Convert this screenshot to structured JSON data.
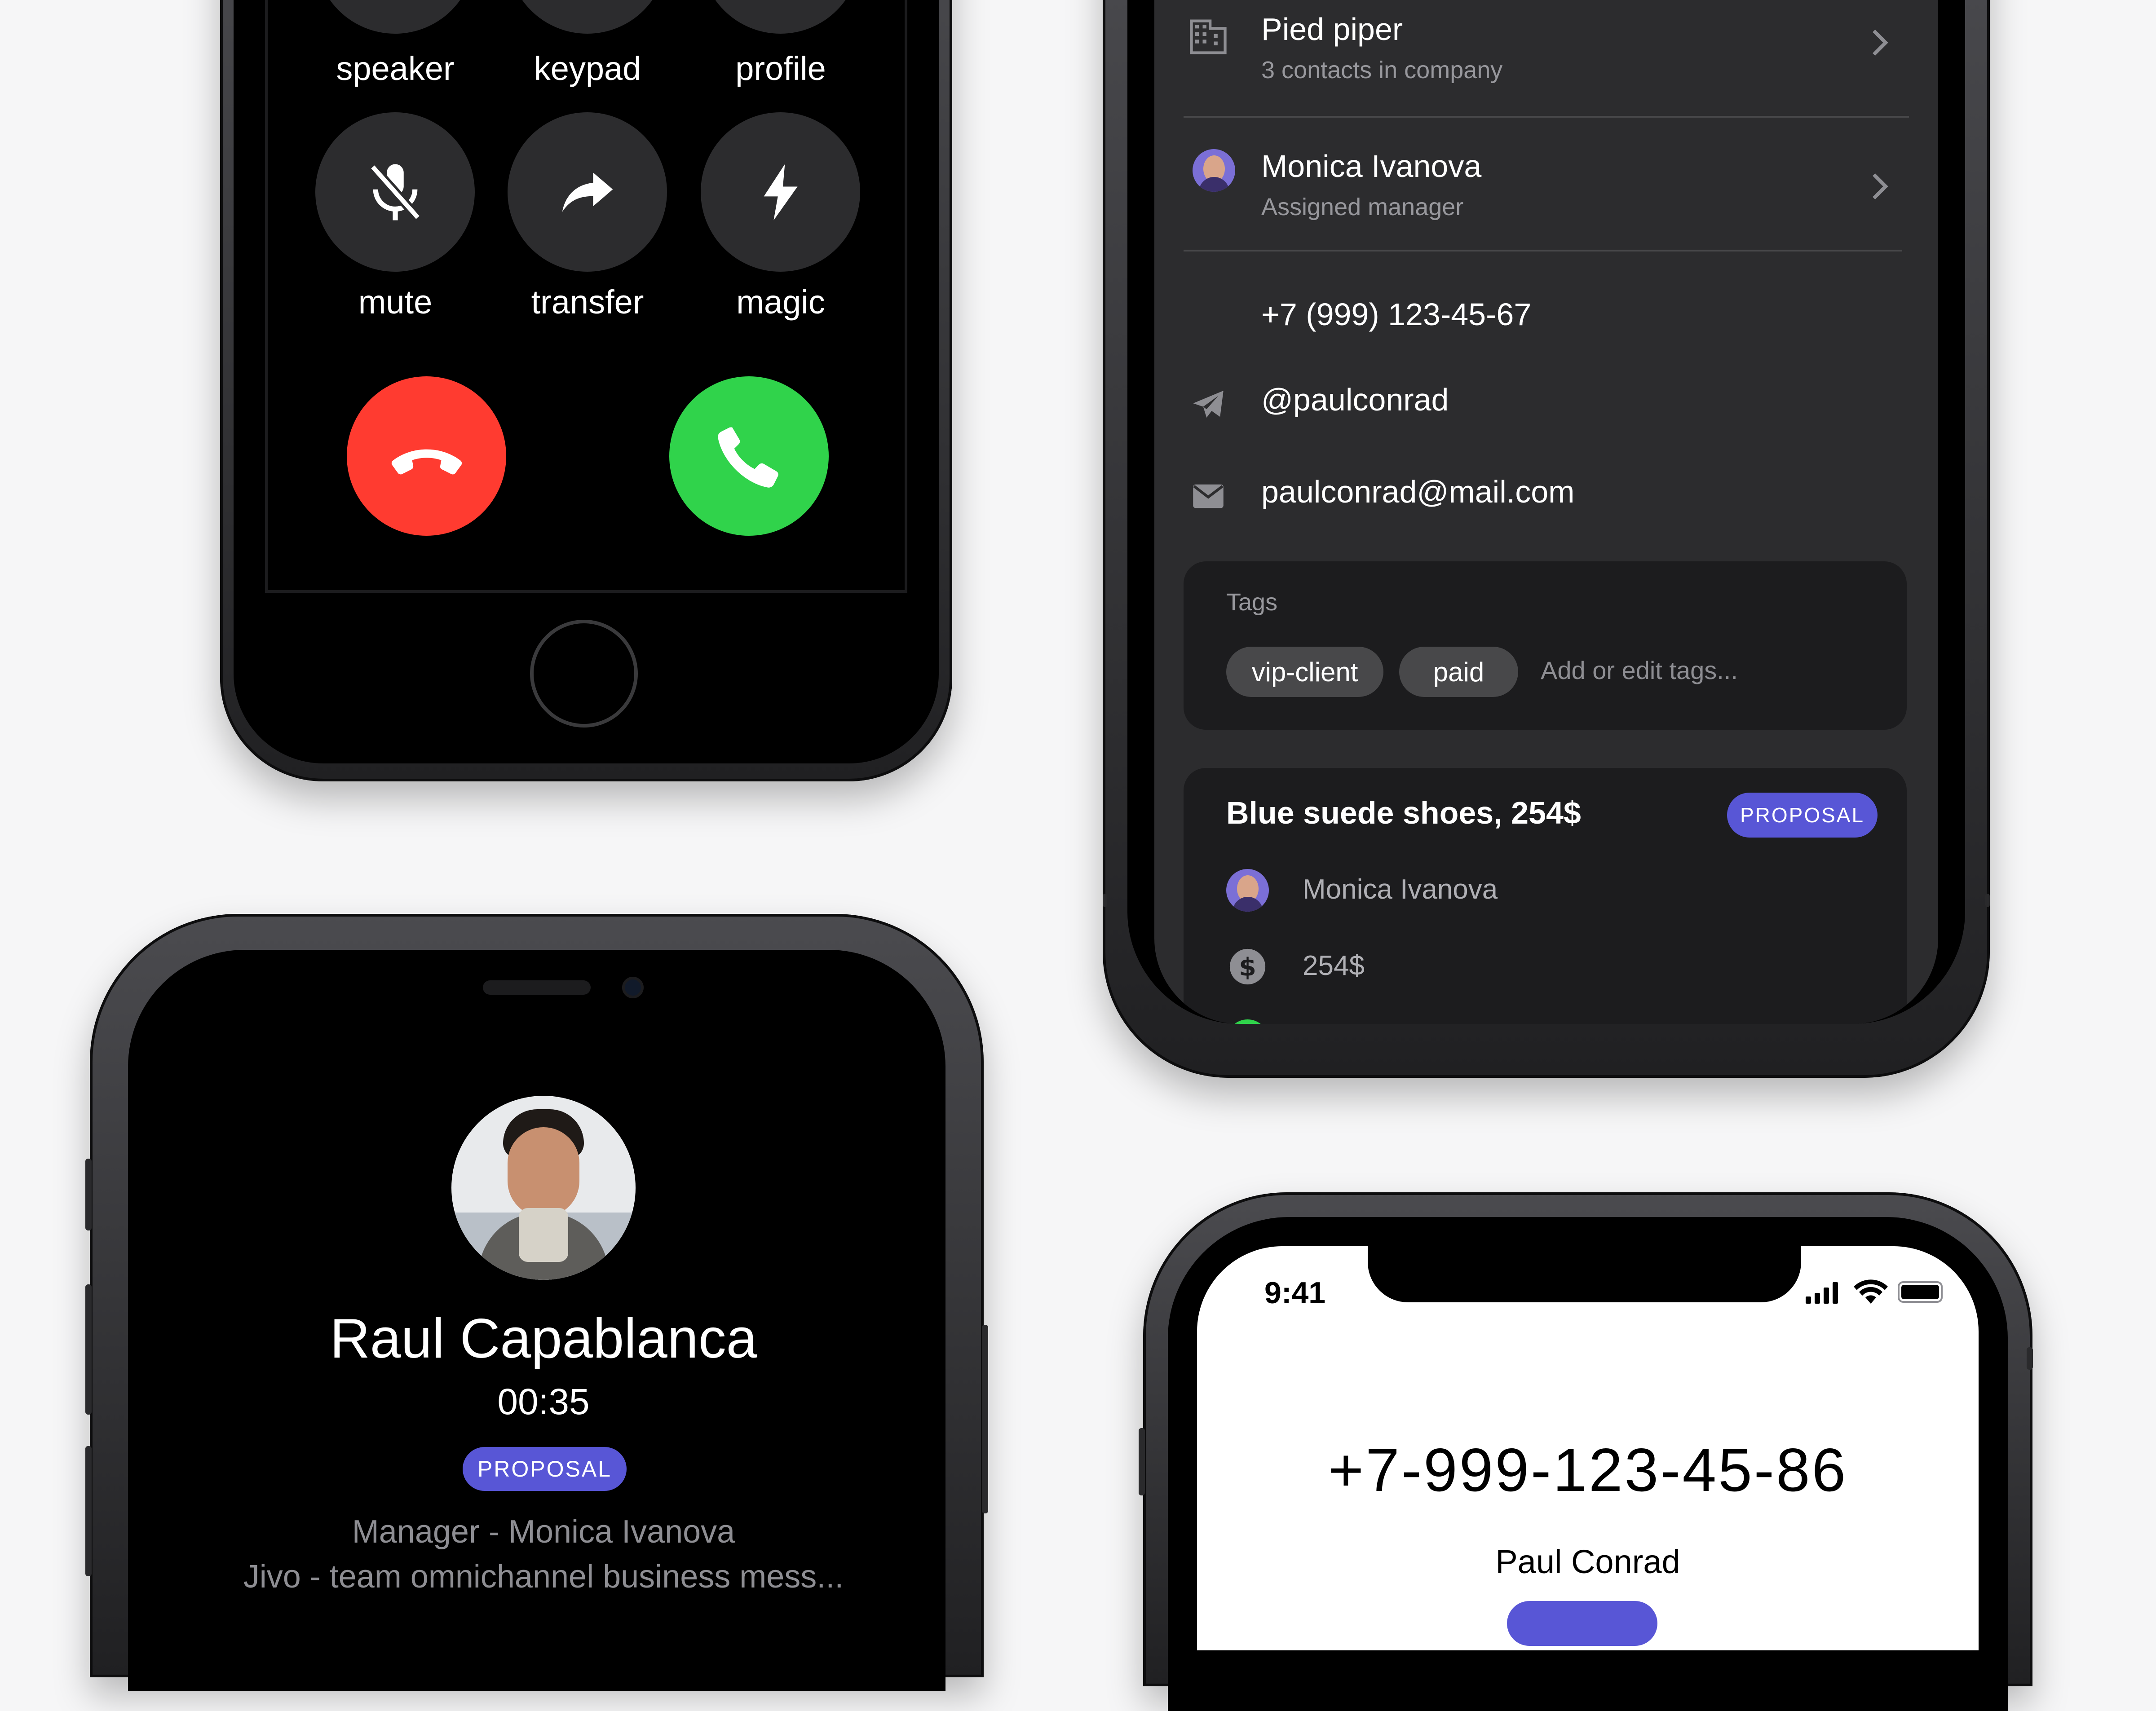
{
  "phone_call_controls": {
    "buttons": [
      {
        "label": "speaker"
      },
      {
        "label": "keypad"
      },
      {
        "label": "profile"
      },
      {
        "label": "mute",
        "icon": "mic-off-icon"
      },
      {
        "label": "transfer",
        "icon": "forward-arrow-icon"
      },
      {
        "label": "magic",
        "icon": "lightning-icon"
      }
    ],
    "decline_icon": "phone-down-icon",
    "accept_icon": "phone-icon",
    "colors": {
      "decline": "#ff3b30",
      "accept": "#30d34b",
      "button_bg": "#2c2c2e"
    }
  },
  "contact_card": {
    "company": {
      "name": "Pied piper",
      "subtitle": "3 contacts in company"
    },
    "manager": {
      "name": "Monica Ivanova",
      "subtitle": "Assigned manager"
    },
    "phone": "+7 (999) 123-45-67",
    "telegram": "@paulconrad",
    "email": "paulconrad@mail.com",
    "tags": {
      "title": "Tags",
      "items": [
        "vip-client",
        "paid"
      ],
      "placeholder": "Add or edit tags..."
    },
    "deal": {
      "title": "Blue suede shoes, 254$",
      "badge": "PROPOSAL",
      "manager": "Monica Ivanova",
      "amount": "254$"
    },
    "colors": {
      "background": "#2c2c2e",
      "card": "#1c1c1e",
      "badge": "#5856d6"
    }
  },
  "incoming_call": {
    "name": "Raul Capablanca",
    "timer": "00:35",
    "badge": "PROPOSAL",
    "line1": "Manager - Monica Ivanova",
    "line2": "Jivo - team omnichannel business mess..."
  },
  "dialer": {
    "time": "9:41",
    "number": "+7-999-123-45-86",
    "name": "Paul Conrad"
  }
}
